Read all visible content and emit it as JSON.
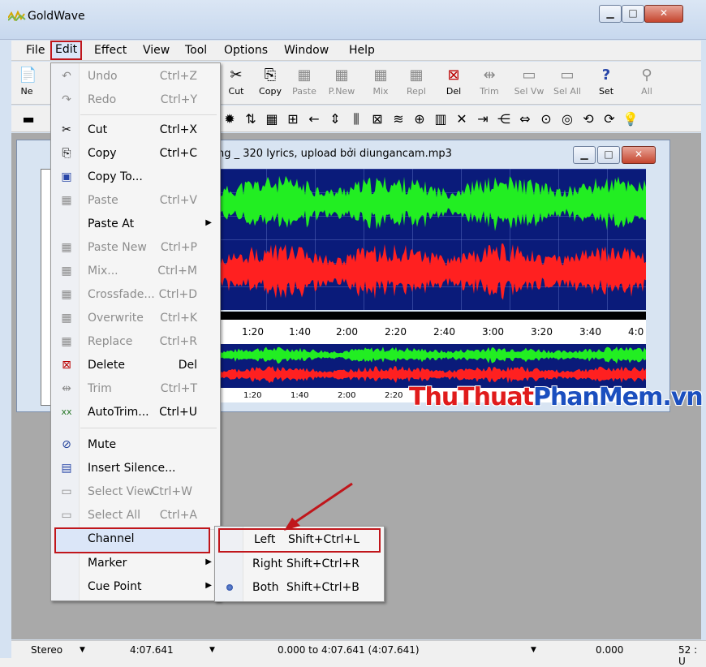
{
  "window": {
    "title": "GoldWave",
    "min": "▁",
    "max": "□",
    "close": "✕"
  },
  "menubar": [
    "File",
    "Edit",
    "Effect",
    "View",
    "Tool",
    "Options",
    "Window",
    "Help"
  ],
  "toolbar1": [
    {
      "label": "Ne",
      "icon": "new-icon",
      "disabled": false
    },
    {
      "label": "Cut",
      "icon": "scissors-icon",
      "disabled": false
    },
    {
      "label": "Copy",
      "icon": "copy-icon",
      "disabled": false
    },
    {
      "label": "Paste",
      "icon": "paste-icon",
      "disabled": true
    },
    {
      "label": "P.New",
      "icon": "paste-new-icon",
      "disabled": true
    },
    {
      "label": "Mix",
      "icon": "mix-icon",
      "disabled": true
    },
    {
      "label": "Repl",
      "icon": "replace-icon",
      "disabled": true
    },
    {
      "label": "Del",
      "icon": "delete-icon",
      "disabled": false
    },
    {
      "label": "Trim",
      "icon": "trim-icon",
      "disabled": true
    },
    {
      "label": "Sel Vw",
      "icon": "select-view-icon",
      "disabled": true
    },
    {
      "label": "Sel All",
      "icon": "select-all-icon",
      "disabled": true
    },
    {
      "label": "Set",
      "icon": "set-icon",
      "disabled": false
    },
    {
      "label": "All",
      "icon": "zoom-all-icon",
      "disabled": true
    }
  ],
  "document": {
    "title": "ng _ 320 lyrics, upload bởi diungancam.mp3"
  },
  "timeline": [
    "1:20",
    "1:40",
    "2:00",
    "2:20",
    "2:40",
    "3:00",
    "3:20",
    "3:40",
    "4:0"
  ],
  "timeline_start": "0",
  "overview_timeline": [
    "1:20",
    "1:40",
    "2:00",
    "2:20"
  ],
  "edit_menu": [
    {
      "label": "Undo",
      "key": "Ctrl+Z",
      "icon": "undo-icon",
      "disabled": true
    },
    {
      "label": "Redo",
      "key": "Ctrl+Y",
      "icon": "redo-icon",
      "disabled": true
    },
    {
      "label": "Cut",
      "key": "Ctrl+X",
      "icon": "scissors-icon",
      "disabled": false
    },
    {
      "label": "Copy",
      "key": "Ctrl+C",
      "icon": "copy-icon",
      "disabled": false
    },
    {
      "label": "Copy To...",
      "key": "",
      "icon": "copy-to-icon",
      "disabled": false
    },
    {
      "label": "Paste",
      "key": "Ctrl+V",
      "icon": "paste-icon",
      "disabled": true
    },
    {
      "label": "Paste At",
      "key": "",
      "icon": "",
      "disabled": false,
      "submenu": true
    },
    {
      "label": "Paste New",
      "key": "Ctrl+P",
      "icon": "paste-new-icon",
      "disabled": true
    },
    {
      "label": "Mix...",
      "key": "Ctrl+M",
      "icon": "mix-icon",
      "disabled": true
    },
    {
      "label": "Crossfade...",
      "key": "Ctrl+D",
      "icon": "crossfade-icon",
      "disabled": true
    },
    {
      "label": "Overwrite",
      "key": "Ctrl+K",
      "icon": "overwrite-icon",
      "disabled": true
    },
    {
      "label": "Replace",
      "key": "Ctrl+R",
      "icon": "replace-icon",
      "disabled": true
    },
    {
      "label": "Delete",
      "key": "Del",
      "icon": "delete-icon",
      "disabled": false
    },
    {
      "label": "Trim",
      "key": "Ctrl+T",
      "icon": "trim-icon",
      "disabled": true
    },
    {
      "label": "AutoTrim...",
      "key": "Ctrl+U",
      "icon": "autotrim-icon",
      "disabled": false
    },
    {
      "label": "Mute",
      "key": "",
      "icon": "mute-icon",
      "disabled": false
    },
    {
      "label": "Insert Silence...",
      "key": "",
      "icon": "insert-silence-icon",
      "disabled": false
    },
    {
      "label": "Select View",
      "key": "Ctrl+W",
      "icon": "select-view-icon",
      "disabled": true
    },
    {
      "label": "Select All",
      "key": "Ctrl+A",
      "icon": "select-all-icon",
      "disabled": true
    },
    {
      "label": "Channel",
      "key": "",
      "icon": "",
      "disabled": false,
      "submenu": false,
      "highlight": true
    },
    {
      "label": "Marker",
      "key": "",
      "icon": "",
      "disabled": false,
      "submenu": true
    },
    {
      "label": "Cue Point",
      "key": "",
      "icon": "",
      "disabled": false,
      "submenu": true
    }
  ],
  "channel_menu": [
    {
      "label": "Left",
      "key": "Shift+Ctrl+L",
      "selected": false,
      "highlight": true
    },
    {
      "label": "Right",
      "key": "Shift+Ctrl+R",
      "selected": false,
      "highlight": false
    },
    {
      "label": "Both",
      "key": "Shift+Ctrl+B",
      "selected": true,
      "highlight": false
    }
  ],
  "status": {
    "mode": "Stereo",
    "length": "4:07.641",
    "selection": "0.000 to 4:07.641 (4:07.641)",
    "position": "0.000",
    "extra": "52 : U"
  },
  "watermark": {
    "part1": "ThuThuat",
    "part2": "PhanMem",
    "part3": ".vn"
  },
  "colors": {
    "left_channel": "#22ee22",
    "right_channel": "#ff2020",
    "wave_bg": "#0a1b7a",
    "highlight_border": "#c0161b"
  }
}
